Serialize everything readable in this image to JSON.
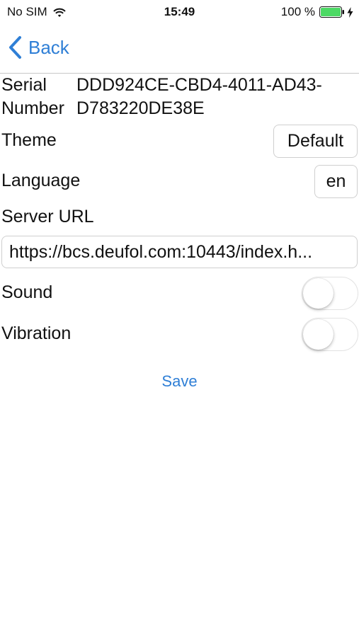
{
  "status_bar": {
    "carrier": "No SIM",
    "time": "15:49",
    "battery_percent": "100 %"
  },
  "nav": {
    "back_label": "Back"
  },
  "settings": {
    "serial": {
      "label_line1": "Serial",
      "label_line2": "Number",
      "value_line1": "DDD924CE-CBD4-4011-AD43-",
      "value_line2": "D783220DE38E"
    },
    "theme": {
      "label": "Theme",
      "value": "Default"
    },
    "language": {
      "label": "Language",
      "value": "en"
    },
    "server_url": {
      "label": "Server URL",
      "value": "https://bcs.deufol.com:10443/index.h..."
    },
    "sound": {
      "label": "Sound",
      "enabled": false
    },
    "vibration": {
      "label": "Vibration",
      "enabled": false
    }
  },
  "actions": {
    "save_label": "Save"
  },
  "colors": {
    "accent": "#2f7fd6",
    "battery": "#4cd964"
  }
}
